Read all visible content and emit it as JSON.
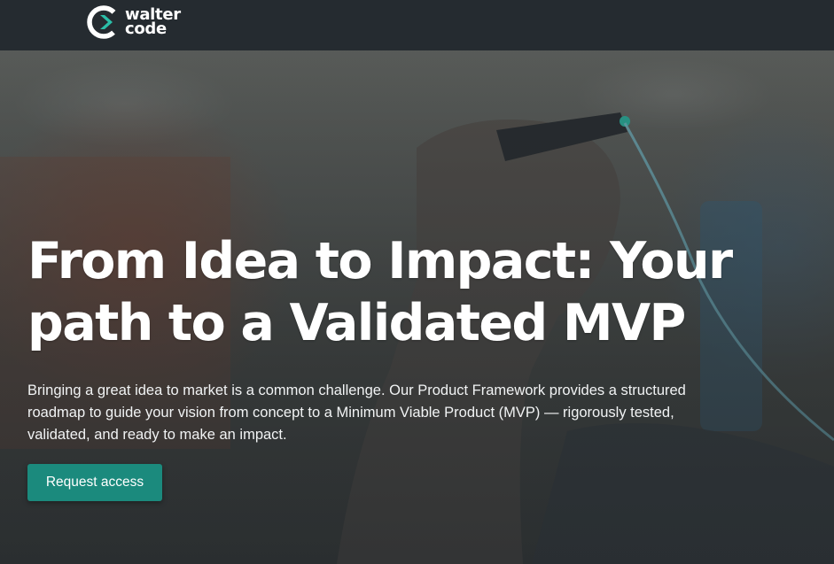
{
  "header": {
    "logo": {
      "line1": "walter",
      "line2": "code"
    }
  },
  "hero": {
    "headline": "From Idea to Impact: Your path to a Validated MVP",
    "description": "Bringing a great idea to market is a common challenge. Our Product Framework provides a structured roadmap to guide your vision from concept to a Minimum Viable Product (MVP) — rigorously tested, validated, and ready to make an impact.",
    "cta_label": "Request access"
  },
  "colors": {
    "topbar": "#252b30",
    "accent": "#1b8a7d",
    "logo_accent": "#2bbfa9",
    "text": "#ffffff"
  }
}
